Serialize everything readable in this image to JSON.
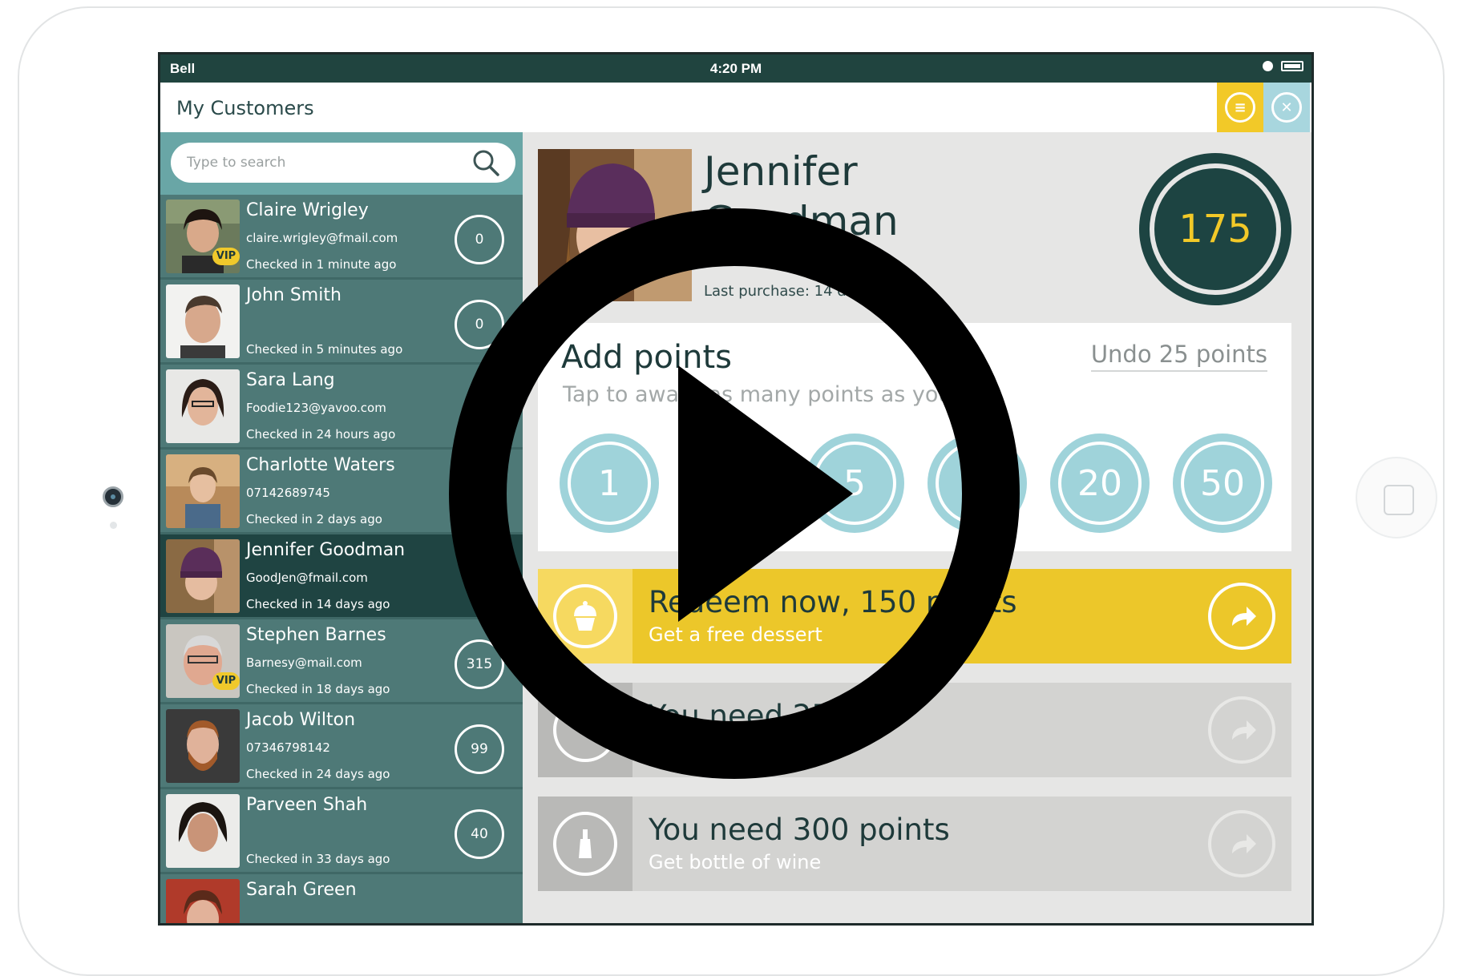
{
  "status": {
    "carrier": "Bell",
    "time": "4:20 PM"
  },
  "header": {
    "title": "My Customers"
  },
  "search": {
    "placeholder": "Type to search"
  },
  "customers": [
    {
      "name": "Claire Wrigley",
      "email": "claire.wrigley@fmail.com",
      "checked": "Checked in 1 minute ago",
      "points": "0",
      "vip": "VIP"
    },
    {
      "name": "John Smith",
      "email": "",
      "checked": "Checked in 5 minutes ago",
      "points": "0"
    },
    {
      "name": "Sara Lang",
      "email": "Foodie123@yavoo.com",
      "checked": "Checked in 24 hours ago",
      "points": ""
    },
    {
      "name": "Charlotte Waters",
      "email": "07142689745",
      "checked": "Checked in 2 days ago",
      "points": ""
    },
    {
      "name": "Jennifer Goodman",
      "email": "GoodJen@fmail.com",
      "checked": "Checked in 14 days ago",
      "points": ""
    },
    {
      "name": "Stephen Barnes",
      "email": "Barnesy@mail.com",
      "checked": "Checked in 18 days ago",
      "points": "315",
      "vip": "VIP"
    },
    {
      "name": "Jacob Wilton",
      "email": "07346798142",
      "checked": "Checked in 24 days ago",
      "points": "99"
    },
    {
      "name": "Parveen Shah",
      "email": "",
      "checked": "Checked in 33 days ago",
      "points": "40"
    },
    {
      "name": "Sarah Green",
      "email": "",
      "checked": "",
      "points": ""
    }
  ],
  "profile": {
    "name": "Jennifer Goodman",
    "last_purchase": "Last purchase: 14 day",
    "points": "175"
  },
  "add_points": {
    "title": "Add points",
    "undo": "Undo 25 points",
    "subtitle": "Tap to award as many points as you",
    "buttons": [
      "1",
      "",
      "5",
      "",
      "20",
      "50"
    ]
  },
  "rewards": [
    {
      "title": "Redeem now, 150 points",
      "subtitle": "Get a free dessert",
      "state": "available",
      "icon": "cupcake-icon"
    },
    {
      "title": "You need 250",
      "subtitle": "",
      "state": "locked",
      "icon": "reward-icon"
    },
    {
      "title": "You need 300 points",
      "subtitle": "Get bottle of wine",
      "state": "locked",
      "icon": "wine-bottle-icon"
    }
  ],
  "colors": {
    "accent_yellow": "#ecc72a",
    "teal_dark": "#1f4442",
    "teal": "#4e7977",
    "light_blue": "#9fd3da"
  }
}
